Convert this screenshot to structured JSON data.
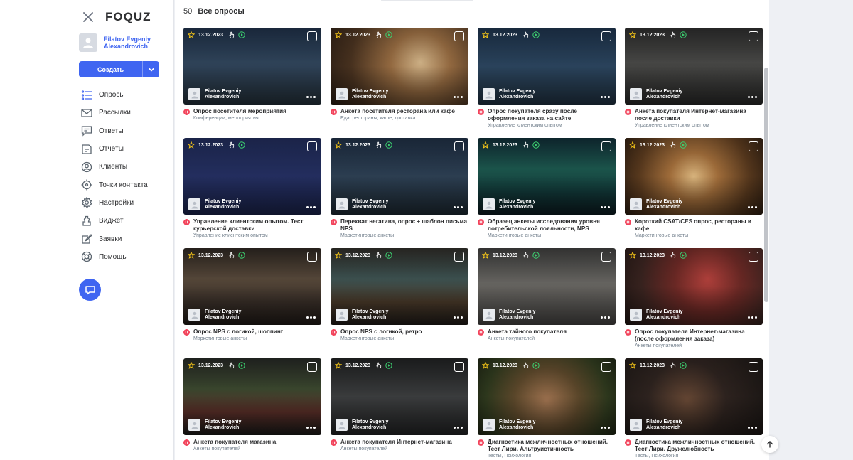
{
  "app": {
    "logo": "FOQUZ"
  },
  "user": {
    "name": "Filatov Evgeniy Alexandrovich"
  },
  "create": {
    "label": "Создать"
  },
  "nav": [
    {
      "label": "Опросы",
      "icon": "list-icon"
    },
    {
      "label": "Рассылки",
      "icon": "mail-icon"
    },
    {
      "label": "Ответы",
      "icon": "answers-icon"
    },
    {
      "label": "Отчёты",
      "icon": "reports-icon"
    },
    {
      "label": "Клиенты",
      "icon": "clients-icon"
    },
    {
      "label": "Точки контакта",
      "icon": "touchpoints-icon"
    },
    {
      "label": "Настройки",
      "icon": "settings-icon"
    },
    {
      "label": "Виджет",
      "icon": "widget-icon"
    },
    {
      "label": "Заявки",
      "icon": "requests-icon"
    },
    {
      "label": "Помощь",
      "icon": "help-icon"
    }
  ],
  "page": {
    "count": "50",
    "title": "Все опросы"
  },
  "card_meta": {
    "date": "13.12.2023",
    "author": "Filatov Evgeniy Alexandrovich"
  },
  "cards": [
    {
      "title": "Опрос посетителя мероприятия",
      "subtitle": "Конференции, мероприятия",
      "bg": "linear-gradient(180deg,#1d2e44 0%,#31465d 45%,#27343f 100%)"
    },
    {
      "title": "Анкета посетителя ресторана или кафе",
      "subtitle": "Еда, рестораны, кафе, доставка",
      "bg": "radial-gradient(circle at 65% 45%,#d8b98c 0%,#9a6e43 30%,#4a3320 70%,#2e2016 100%)"
    },
    {
      "title": "Опрос покупателя сразу после оформления заказа на сайте",
      "subtitle": "Управление клиентским опытом",
      "bg": "linear-gradient(180deg,#1c3047 0%,#2c4660 50%,#233647 100%)"
    },
    {
      "title": "Анкета покупателя Интернет-магазина после доставки",
      "subtitle": "Управление клиентским опытом",
      "bg": "linear-gradient(180deg,#2a2a2a 0%,#4a4a48 45%,#2c2c2b 100%)"
    },
    {
      "title": "Управление клиентским опытом. Тест курьерской доставки",
      "subtitle": "Управление клиентским опытом",
      "bg": "linear-gradient(180deg,#1f2a55 0%,#253063 50%,#1c2550 100%)"
    },
    {
      "title": "Перехват негатива, опрос + шаблон письма NPS",
      "subtitle": "Маркетинговые анкеты",
      "bg": "linear-gradient(180deg,#1d2c40 0%,#2e4155 50%,#1f2c36 100%)"
    },
    {
      "title": "Образец анкеты исследования уровня потребительской лояльности, NPS",
      "subtitle": "Маркетинговые анкеты",
      "bg": "linear-gradient(180deg,#0f2a33 0%,#1d5a50 40%,#123a3a 70%,#0c1d22 100%)"
    },
    {
      "title": "Короткий CSAT/CES опрос, рестораны и кафе",
      "subtitle": "Маркетинговые анкеты",
      "bg": "radial-gradient(circle at 50% 50%,#e3bd83 0%,#a8723d 30%,#5a3a1e 70%,#2f1f12 100%)"
    },
    {
      "title": "Опрос NPS с логикой, шоппинг",
      "subtitle": "Маркетинговые анкеты",
      "bg": "linear-gradient(180deg,#2b2520 0%,#5a4b3c 40%,#3a3029 70%,#221c18 100%)"
    },
    {
      "title": "Опрос NPS с логикой, ретро",
      "subtitle": "Маркетинговые анкеты",
      "bg": "linear-gradient(180deg,#2c2a26 0%,#3f5554 40%,#4a3a2a 70%,#221d19 100%)"
    },
    {
      "title": "Анкета тайного покупателя",
      "subtitle": "Анкеты покупателей",
      "bg": "linear-gradient(180deg,#3b3b3a 0%,#6b6965 45%,#4a4846 100%)"
    },
    {
      "title": "Опрос покупателя Интернет-магазина (после оформления заказа)",
      "subtitle": "Анкеты покупателей",
      "bg": "radial-gradient(circle at 60% 40%,#b9433e 0%,#6f2a26 35%,#3a2420 70%,#221714 100%)"
    },
    {
      "title": "Анкета покупателя магазина",
      "subtitle": "Анкеты покупателей",
      "bg": "linear-gradient(180deg,#232623 0%,#3d4a30 40%,#5a2e28 70%,#1c1c1a 100%)"
    },
    {
      "title": "Анкета покупателя Интернет-магазина",
      "subtitle": "Анкеты покупателей",
      "bg": "linear-gradient(180deg,#1f2021 0%,#3d3f40 50%,#252627 100%)"
    },
    {
      "title": "Диагностика межличностных отношений. Тест Лири. Альтруистичность",
      "subtitle": "Тесты, Психология",
      "bg": "radial-gradient(circle at 50% 55%,#a47652 0%,#5f4a2c 40%,#2f3a1e 75%,#1e2414 100%)"
    },
    {
      "title": "Диагностика межличностных отношений. Тест Лири. Дружелюбность",
      "subtitle": "Тесты, Психология",
      "bg": "radial-gradient(circle at 45% 55%,#6a4a36 0%,#2f2420 45%,#1a1614 100%)"
    }
  ]
}
